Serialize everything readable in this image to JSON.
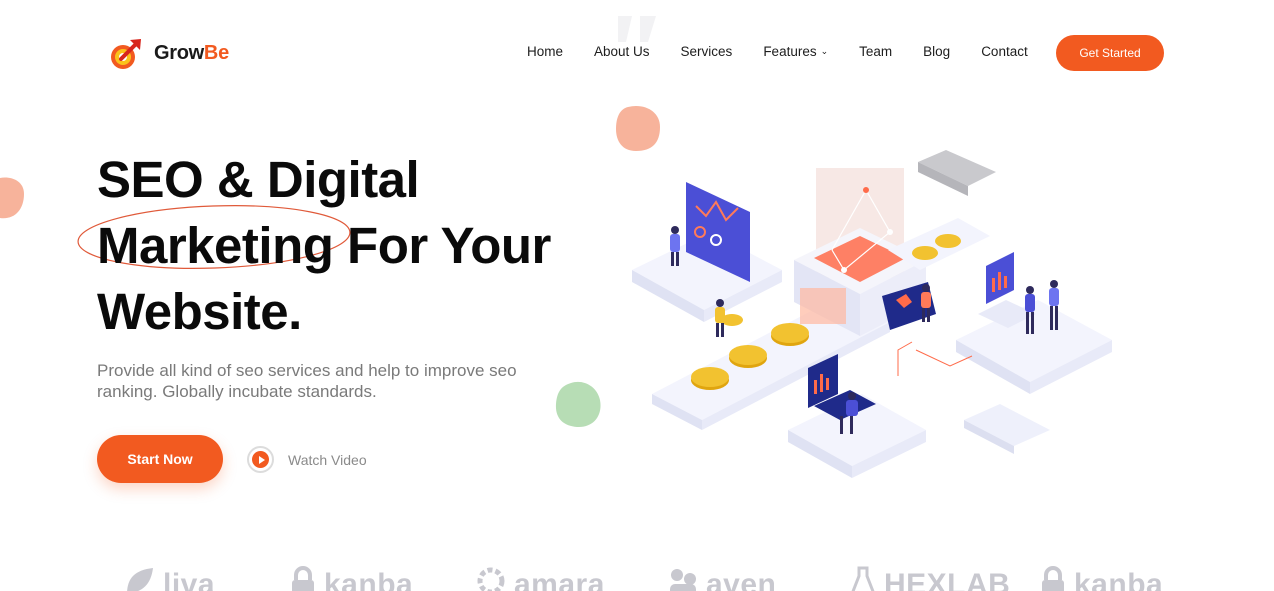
{
  "brand": {
    "name_part1": "Grow",
    "name_part2": "Be",
    "accent": "#f25a20"
  },
  "nav": {
    "items": [
      {
        "label": "Home"
      },
      {
        "label": "About Us"
      },
      {
        "label": "Services"
      },
      {
        "label": "Features",
        "has_dropdown": true
      },
      {
        "label": "Team"
      },
      {
        "label": "Blog"
      },
      {
        "label": "Contact"
      }
    ],
    "cta_label": "Get Started"
  },
  "hero": {
    "title_line1": "SEO & Digital",
    "title_highlight": "Marketing",
    "title_line2_rest": " For Your",
    "title_line3": "Website.",
    "subtitle": "Provide all kind of seo services and help to improve seo ranking. Globally incubate standards.",
    "primary_button": "Start Now",
    "video_link": "Watch Video"
  },
  "partners": [
    {
      "name": "liva",
      "icon": "leaf-icon"
    },
    {
      "name": "kanba",
      "icon": "lock-icon"
    },
    {
      "name": "amara",
      "icon": "gear-icon"
    },
    {
      "name": "aven",
      "icon": "people-icon"
    },
    {
      "name": "HEXLAB",
      "icon": "flask-icon"
    },
    {
      "name": "kanba",
      "icon": "lock-icon"
    }
  ],
  "colors": {
    "accent": "#f25a20",
    "blob_peach": "#f7b39b",
    "blob_green": "#b7ddb5",
    "illustration_blue": "#4b4fd6",
    "coin_gold": "#f2c230",
    "partner_grey": "#c8c8cf"
  }
}
